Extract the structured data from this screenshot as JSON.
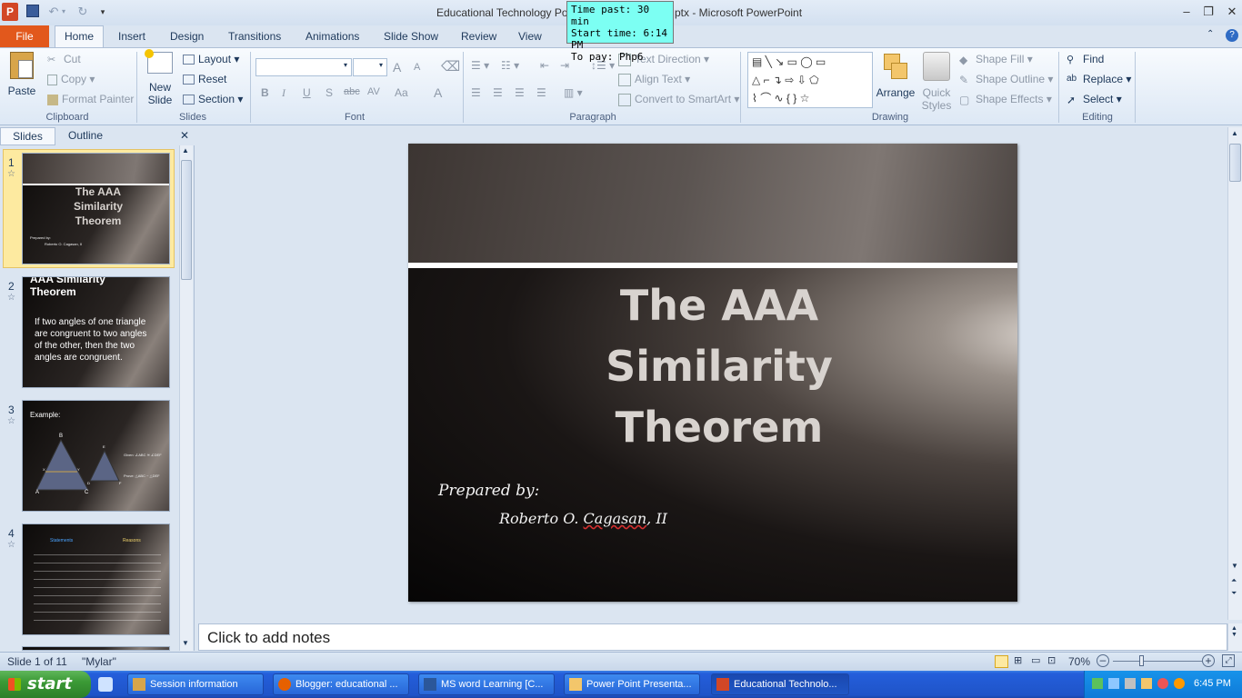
{
  "window": {
    "title": "Educational Technology Pov",
    "title_suffix": "ptx  -  Microsoft PowerPoint"
  },
  "timer_overlay": {
    "line1": "Time past: 30 min",
    "line2": "Start time: 6:14 PM",
    "line3": "To pay: Php6"
  },
  "tabs": [
    "File",
    "Home",
    "Insert",
    "Design",
    "Transitions",
    "Animations",
    "Slide Show",
    "Review",
    "View"
  ],
  "ribbon": {
    "clipboard": {
      "paste": "Paste",
      "cut": "Cut",
      "copy": "Copy",
      "format_painter": "Format Painter",
      "label": "Clipboard"
    },
    "slides": {
      "new_slide_1": "New",
      "new_slide_2": "Slide",
      "layout": "Layout",
      "reset": "Reset",
      "section": "Section",
      "label": "Slides"
    },
    "font": {
      "label": "Font",
      "bold": "B",
      "italic": "I",
      "underline": "U",
      "shadow": "S",
      "strike": "abc",
      "spacing": "AV",
      "case": "Aa",
      "color": "A",
      "grow": "A",
      "shrink": "A"
    },
    "paragraph": {
      "label": "Paragraph",
      "text_direction": "Text Direction",
      "align_text": "Align Text",
      "convert": "Convert to SmartArt"
    },
    "drawing": {
      "label": "Drawing",
      "arrange": "Arrange",
      "quick_styles_1": "Quick",
      "quick_styles_2": "Styles",
      "shape_fill": "Shape Fill",
      "shape_outline": "Shape Outline",
      "shape_effects": "Shape Effects"
    },
    "editing": {
      "label": "Editing",
      "find": "Find",
      "replace": "Replace",
      "select": "Select"
    }
  },
  "left_pane": {
    "tab_slides": "Slides",
    "tab_outline": "Outline",
    "thumbs": [
      {
        "num": "1",
        "title": "The AAA Similarity Theorem",
        "sub": "Prepared by:",
        "author": "Roberto O. Cagasan, II"
      },
      {
        "num": "2",
        "title": "AAA Similarity Theorem",
        "body": "If two angles of one triangle are congruent to two angles of the other, then the two angles are congruent."
      },
      {
        "num": "3",
        "title": "Example:",
        "labels": [
          "B",
          "A",
          "C",
          "X",
          "Y",
          "E",
          "D",
          "F"
        ],
        "note1": "Given: ∠ABC ≅ ∠DEF",
        "note2": "Prove: △ABC ~ △DEF"
      },
      {
        "num": "4",
        "col1": "Statements",
        "col2": "Reasons"
      }
    ]
  },
  "slide": {
    "title_line1": "The AAA",
    "title_line2": "Similarity",
    "title_line3": "Theorem",
    "prepared": "Prepared by:",
    "author_first": "Roberto O. ",
    "author_last": "Cagasan",
    "author_suffix": ", II"
  },
  "notes_placeholder": "Click to add notes",
  "status": {
    "slide_info": "Slide 1 of 11",
    "theme": "\"Mylar\"",
    "zoom": "70%"
  },
  "taskbar": {
    "start": "start",
    "tasks": [
      {
        "label": "Session information"
      },
      {
        "label": "Blogger: educational ..."
      },
      {
        "label": "MS word Learning [C..."
      },
      {
        "label": "Power Point Presenta..."
      },
      {
        "label": "Educational Technolo..."
      }
    ],
    "clock": "6:45 PM"
  },
  "colors": {
    "file_tab": "#e2581c",
    "timer_bg": "#7cfff3",
    "taskbar": "#245edb",
    "start": "#3b9a36"
  }
}
